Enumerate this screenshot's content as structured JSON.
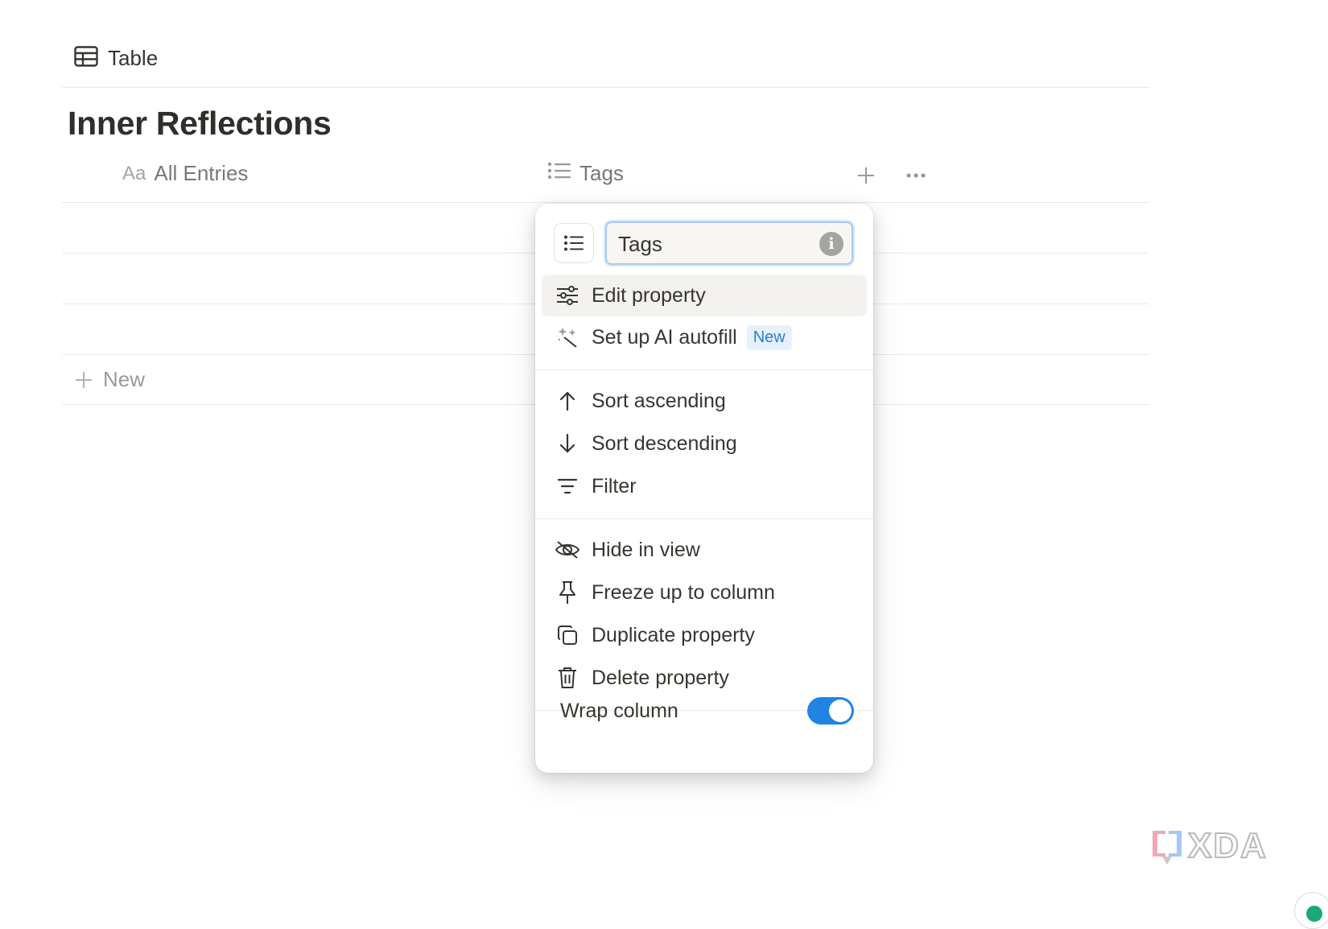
{
  "view": {
    "label": "Table",
    "icon": "table-icon"
  },
  "page": {
    "title": "Inner Reflections"
  },
  "table": {
    "columns": [
      {
        "label": "All Entries",
        "type_label": "Aa",
        "icon": "text-type-icon"
      },
      {
        "label": "Tags",
        "icon": "list-type-icon"
      }
    ],
    "new_row_label": "New"
  },
  "menu": {
    "property_name_value": "Tags",
    "items_group1": [
      {
        "label": "Edit property",
        "icon": "sliders-icon",
        "highlighted": true
      },
      {
        "label": "Set up AI autofill",
        "icon": "sparkle-icon",
        "badge": "New"
      }
    ],
    "items_group2": [
      {
        "label": "Sort ascending",
        "icon": "arrow-up-icon"
      },
      {
        "label": "Sort descending",
        "icon": "arrow-down-icon"
      },
      {
        "label": "Filter",
        "icon": "filter-icon"
      }
    ],
    "items_group3": [
      {
        "label": "Hide in view",
        "icon": "eye-off-icon"
      },
      {
        "label": "Freeze up to column",
        "icon": "pin-icon"
      },
      {
        "label": "Duplicate property",
        "icon": "duplicate-icon"
      },
      {
        "label": "Delete property",
        "icon": "trash-icon"
      }
    ],
    "wrap_column": {
      "label": "Wrap column",
      "enabled": true
    }
  },
  "colors": {
    "accent": "#2383e2",
    "badge_bg": "#e7f1fb",
    "badge_text": "#2b7fd0"
  }
}
